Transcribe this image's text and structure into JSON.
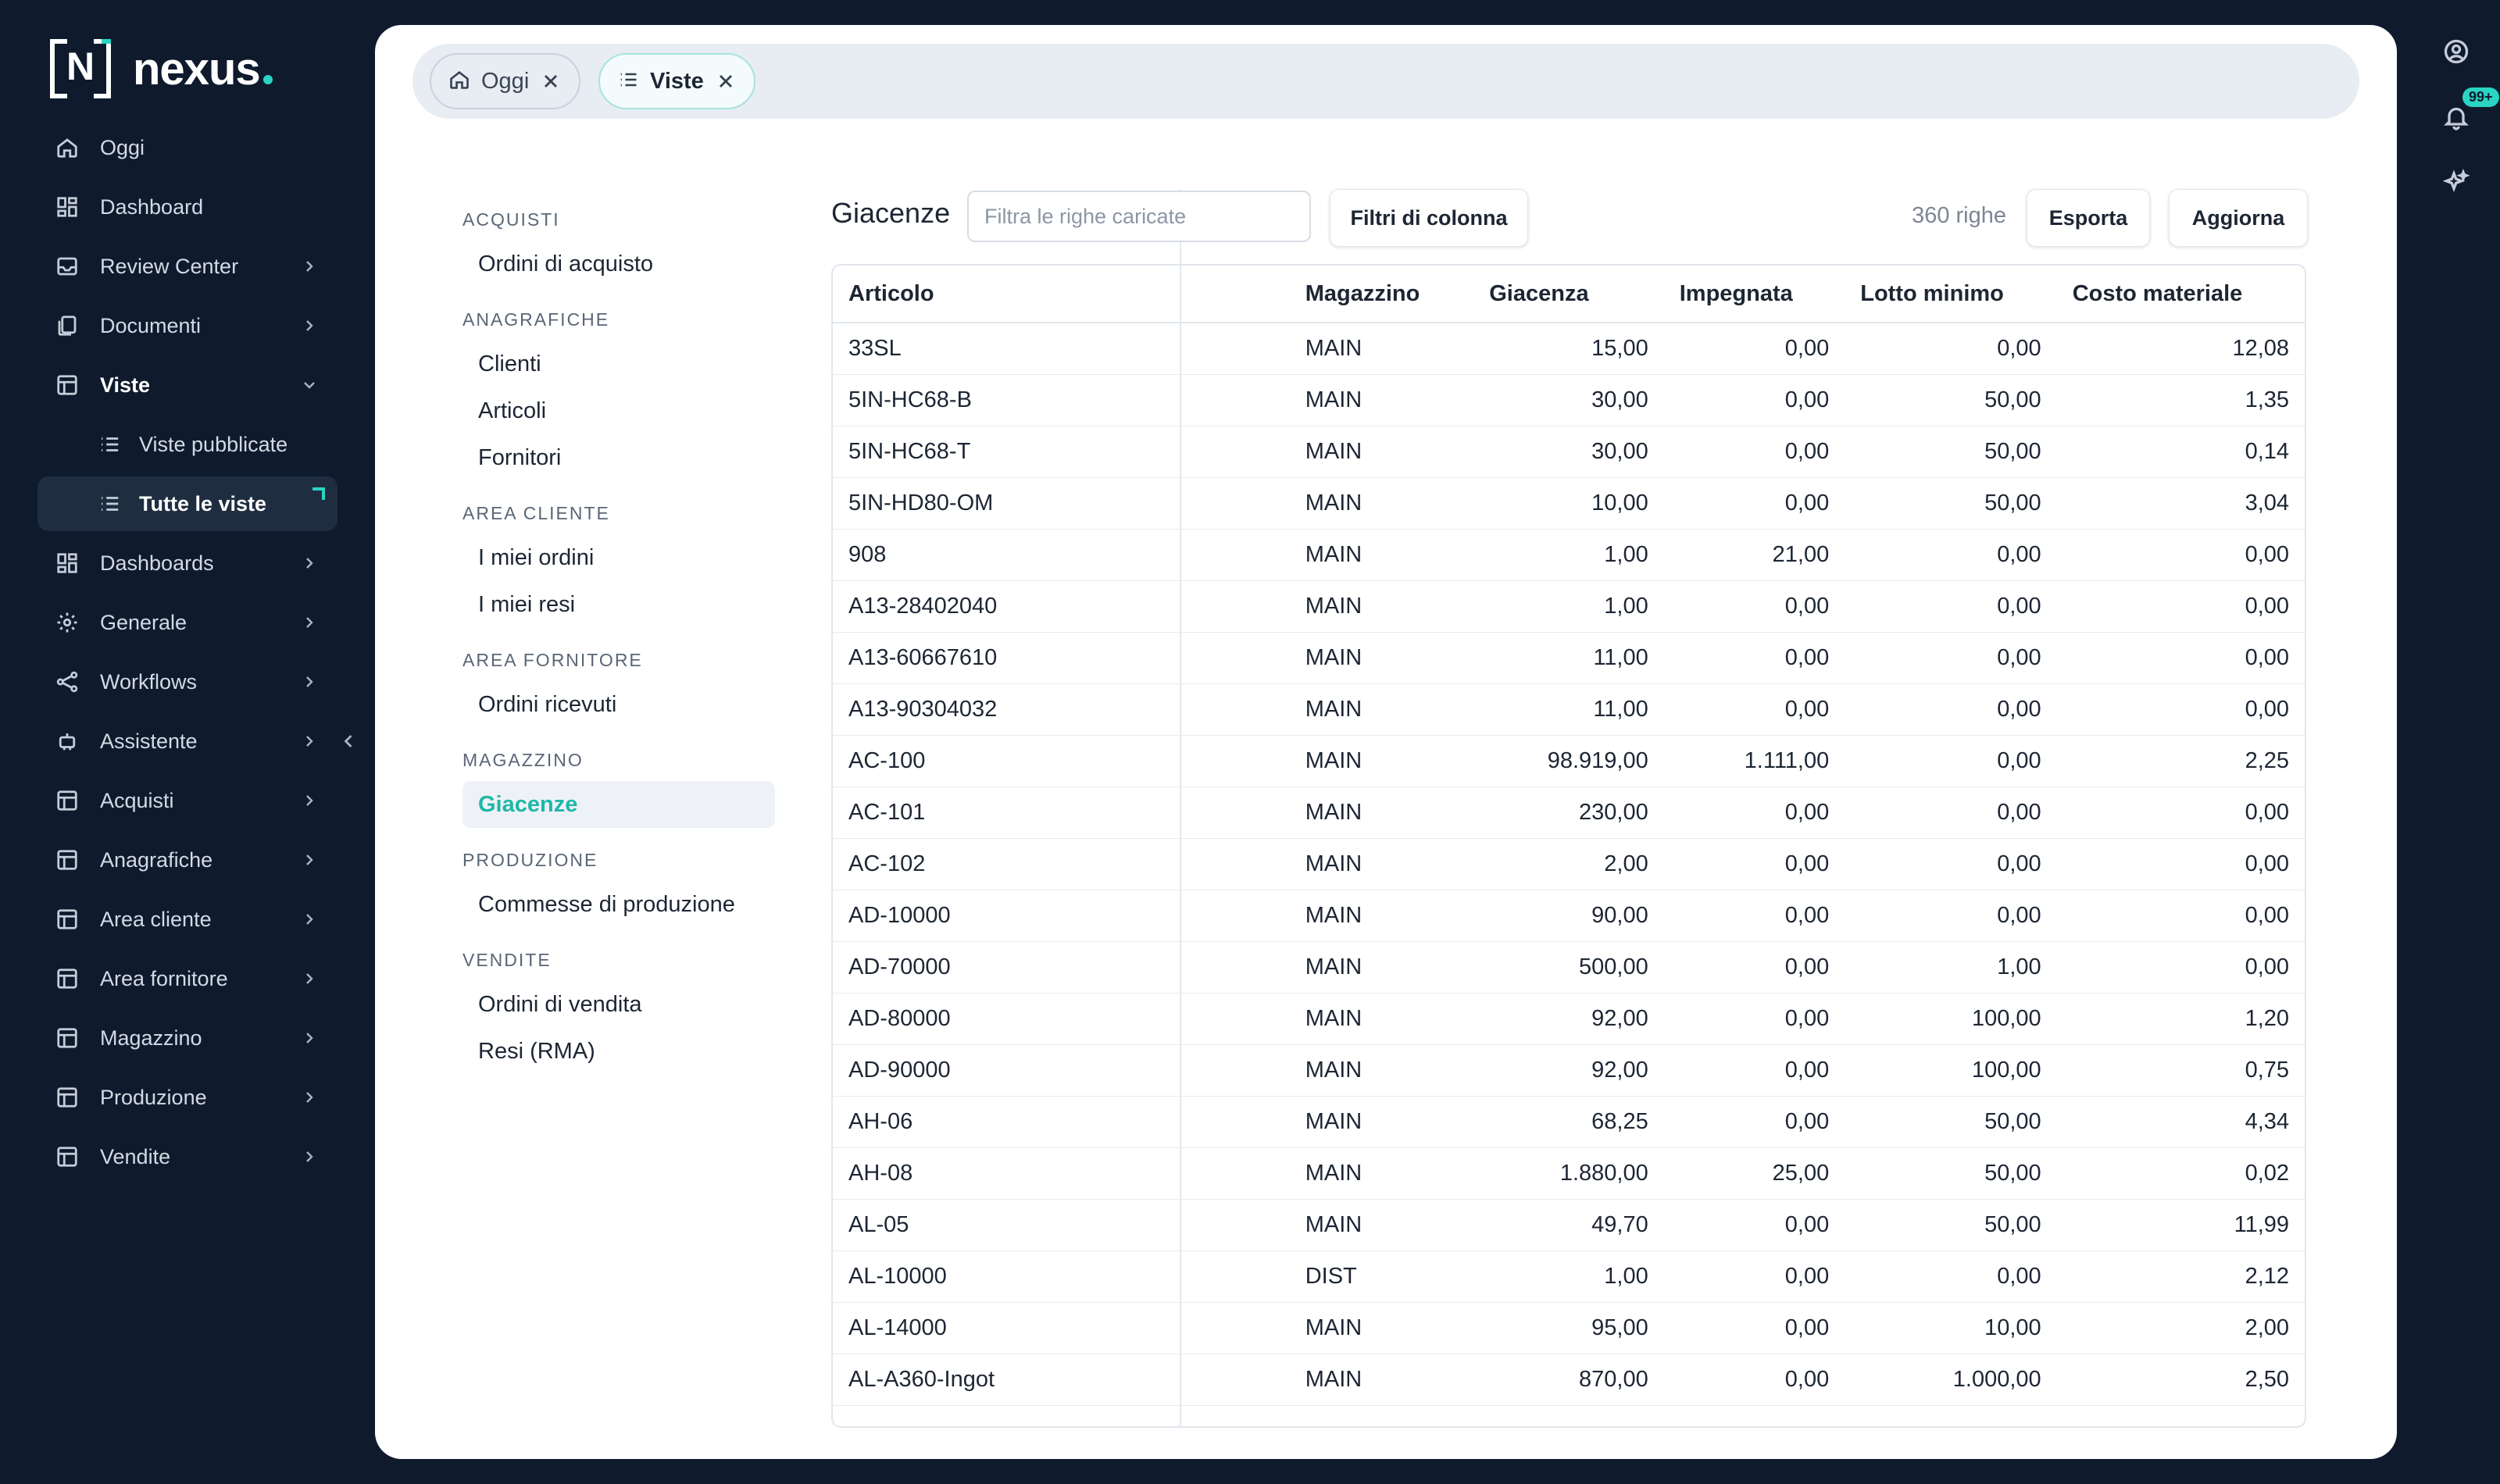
{
  "brand": {
    "name": "nexus",
    "mark": "N"
  },
  "sidebar": {
    "items": [
      {
        "label": "Oggi",
        "icon": "home-icon"
      },
      {
        "label": "Dashboard",
        "icon": "dashboard-icon"
      },
      {
        "label": "Review Center",
        "icon": "inbox-icon"
      },
      {
        "label": "Documenti",
        "icon": "documents-icon"
      },
      {
        "label": "Viste",
        "icon": "table-icon"
      },
      {
        "label": "Viste pubblicate",
        "icon": "list-icon"
      },
      {
        "label": "Tutte le viste",
        "icon": "list-icon"
      },
      {
        "label": "Dashboards",
        "icon": "dashboard-icon"
      },
      {
        "label": "Generale",
        "icon": "gear-icon"
      },
      {
        "label": "Workflows",
        "icon": "share-icon"
      },
      {
        "label": "Assistente",
        "icon": "robot-icon"
      },
      {
        "label": "Acquisti",
        "icon": "table-icon"
      },
      {
        "label": "Anagrafiche",
        "icon": "table-icon"
      },
      {
        "label": "Area cliente",
        "icon": "table-icon"
      },
      {
        "label": "Area fornitore",
        "icon": "table-icon"
      },
      {
        "label": "Magazzino",
        "icon": "table-icon"
      },
      {
        "label": "Produzione",
        "icon": "table-icon"
      },
      {
        "label": "Vendite",
        "icon": "table-icon"
      }
    ]
  },
  "rail": {
    "notification_badge": "99+"
  },
  "tabs": [
    {
      "label": "Oggi",
      "icon": "home-icon"
    },
    {
      "label": "Viste",
      "icon": "list-icon"
    }
  ],
  "views": {
    "sections": [
      {
        "title": "ACQUISTI",
        "items": [
          "Ordini di acquisto"
        ]
      },
      {
        "title": "ANAGRAFICHE",
        "items": [
          "Clienti",
          "Articoli",
          "Fornitori"
        ]
      },
      {
        "title": "AREA CLIENTE",
        "items": [
          "I miei ordini",
          "I miei resi"
        ]
      },
      {
        "title": "AREA FORNITORE",
        "items": [
          "Ordini ricevuti"
        ]
      },
      {
        "title": "MAGAZZINO",
        "items": [
          "Giacenze"
        ]
      },
      {
        "title": "PRODUZIONE",
        "items": [
          "Commesse di produzione"
        ]
      },
      {
        "title": "VENDITE",
        "items": [
          "Ordini di vendita",
          "Resi (RMA)"
        ]
      }
    ]
  },
  "grid": {
    "title": "Giacenze",
    "filter_placeholder": "Filtra le righe caricate",
    "column_filters_label": "Filtri di colonna",
    "row_count": "360 righe",
    "export_label": "Esporta",
    "refresh_label": "Aggiorna",
    "columns": [
      "Articolo",
      "Magazzino",
      "Giacenza",
      "Impegnata",
      "Lotto minimo",
      "Costo materiale"
    ],
    "rows": [
      [
        "33SL",
        "MAIN",
        "15,00",
        "0,00",
        "0,00",
        "12,08"
      ],
      [
        "5IN-HC68-B",
        "MAIN",
        "30,00",
        "0,00",
        "50,00",
        "1,35"
      ],
      [
        "5IN-HC68-T",
        "MAIN",
        "30,00",
        "0,00",
        "50,00",
        "0,14"
      ],
      [
        "5IN-HD80-OM",
        "MAIN",
        "10,00",
        "0,00",
        "50,00",
        "3,04"
      ],
      [
        "908",
        "MAIN",
        "1,00",
        "21,00",
        "0,00",
        "0,00"
      ],
      [
        "A13-28402040",
        "MAIN",
        "1,00",
        "0,00",
        "0,00",
        "0,00"
      ],
      [
        "A13-60667610",
        "MAIN",
        "11,00",
        "0,00",
        "0,00",
        "0,00"
      ],
      [
        "A13-90304032",
        "MAIN",
        "11,00",
        "0,00",
        "0,00",
        "0,00"
      ],
      [
        "AC-100",
        "MAIN",
        "98.919,00",
        "1.111,00",
        "0,00",
        "2,25"
      ],
      [
        "AC-101",
        "MAIN",
        "230,00",
        "0,00",
        "0,00",
        "0,00"
      ],
      [
        "AC-102",
        "MAIN",
        "2,00",
        "0,00",
        "0,00",
        "0,00"
      ],
      [
        "AD-10000",
        "MAIN",
        "90,00",
        "0,00",
        "0,00",
        "0,00"
      ],
      [
        "AD-70000",
        "MAIN",
        "500,00",
        "0,00",
        "1,00",
        "0,00"
      ],
      [
        "AD-80000",
        "MAIN",
        "92,00",
        "0,00",
        "100,00",
        "1,20"
      ],
      [
        "AD-90000",
        "MAIN",
        "92,00",
        "0,00",
        "100,00",
        "0,75"
      ],
      [
        "AH-06",
        "MAIN",
        "68,25",
        "0,00",
        "50,00",
        "4,34"
      ],
      [
        "AH-08",
        "MAIN",
        "1.880,00",
        "25,00",
        "50,00",
        "0,02"
      ],
      [
        "AL-05",
        "MAIN",
        "49,70",
        "0,00",
        "50,00",
        "11,99"
      ],
      [
        "AL-10000",
        "DIST",
        "1,00",
        "0,00",
        "0,00",
        "2,12"
      ],
      [
        "AL-14000",
        "MAIN",
        "95,00",
        "0,00",
        "10,00",
        "2,00"
      ],
      [
        "AL-A360-Ingot",
        "MAIN",
        "870,00",
        "0,00",
        "1.000,00",
        "2,50"
      ]
    ]
  }
}
